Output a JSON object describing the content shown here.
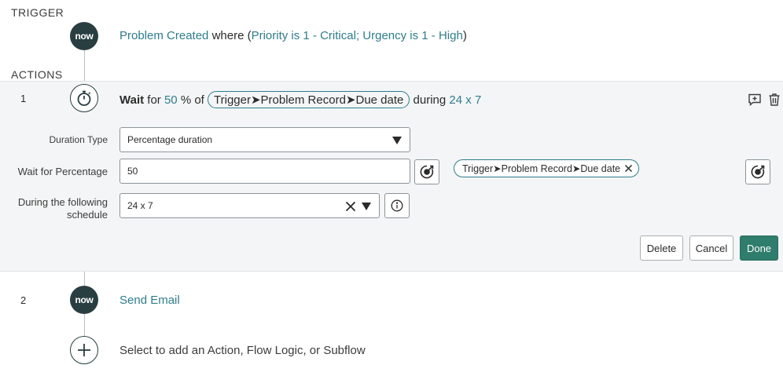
{
  "trigger": {
    "section_label": "TRIGGER",
    "logo_text": "now",
    "title": "Problem Created",
    "where_word": "where (",
    "condition": "Priority is 1 - Critical; Urgency is 1 - High",
    "close_paren": ")"
  },
  "actions": {
    "section_label": "ACTIONS",
    "step1": {
      "number": "1",
      "summary": {
        "wait_word": "Wait",
        "for_word": "for",
        "percent_value": "50",
        "percent_of": "% of",
        "pill_text": "Trigger➤Problem Record➤Due date",
        "during_word": "during",
        "schedule_value": "24 x 7"
      },
      "fields": {
        "duration_type": {
          "label": "Duration Type",
          "value": "Percentage duration"
        },
        "wait_for_percentage": {
          "label": "Wait for Percentage",
          "value": "50",
          "pill": "Trigger➤Problem Record➤Due date"
        },
        "schedule": {
          "label_line1": "During the following",
          "label_line2": "schedule",
          "value": "24 x 7"
        }
      },
      "buttons": {
        "delete": "Delete",
        "cancel": "Cancel",
        "done": "Done"
      }
    },
    "step2": {
      "number": "2",
      "logo_text": "now",
      "title": "Send Email"
    },
    "add_prompt": "Select to add an Action, Flow Logic, or Subflow"
  },
  "colors": {
    "teal_text": "#2e7d8c",
    "dark_icon": "#293e40",
    "primary_button": "#2f7d6c",
    "panel_bg": "#f4f5f6"
  },
  "icons": [
    "stopwatch-icon",
    "comment-add-icon",
    "trash-icon",
    "data-pill-picker-icon",
    "clear-icon",
    "chevron-down-icon",
    "info-icon",
    "plus-icon"
  ]
}
